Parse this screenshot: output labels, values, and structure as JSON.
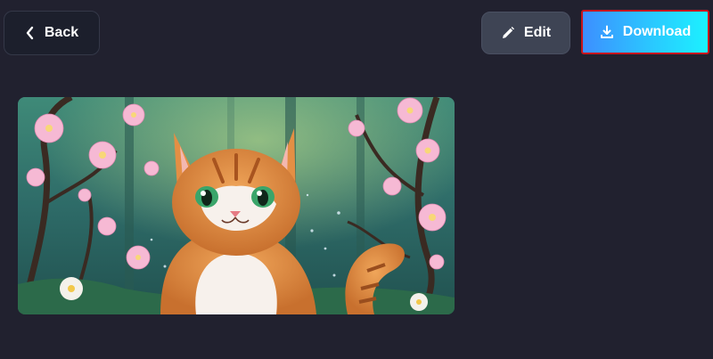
{
  "toolbar": {
    "back_label": "Back",
    "edit_label": "Edit",
    "download_label": "Download"
  },
  "icons": {
    "back": "chevron-left-icon",
    "edit": "pencil-icon",
    "download": "download-icon"
  },
  "colors": {
    "background": "#21212f",
    "download_gradient_start": "#3d8fff",
    "download_gradient_end": "#1cf1ff",
    "highlight_border": "#c8151e"
  }
}
